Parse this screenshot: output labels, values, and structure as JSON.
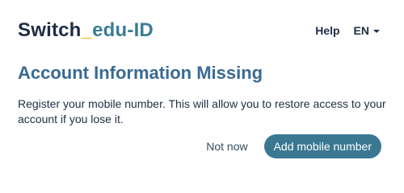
{
  "header": {
    "logo_brand": "Switch",
    "logo_separator": "_",
    "logo_product": "edu-ID",
    "help_label": "Help",
    "language": "EN"
  },
  "dialog": {
    "title": "Account Information Missing",
    "message": "Register your mobile number. This will allow you to restore access to your account if you lose it.",
    "secondary_label": "Not now",
    "primary_label": "Add mobile number"
  },
  "colors": {
    "brand_dark": "#1e2d45",
    "brand_accent": "#f2b10a",
    "brand_teal": "#3a7d94",
    "title": "#3a6a92",
    "button_primary": "#3a7892"
  }
}
